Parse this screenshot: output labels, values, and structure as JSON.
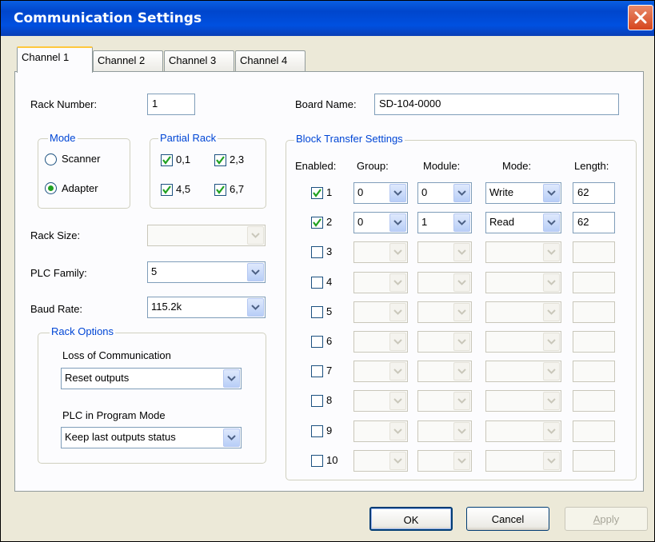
{
  "window": {
    "title": "Communication Settings"
  },
  "tabs": [
    {
      "label": "Channel 1",
      "active": true
    },
    {
      "label": "Channel 2",
      "active": false
    },
    {
      "label": "Channel 3",
      "active": false
    },
    {
      "label": "Channel 4",
      "active": false
    }
  ],
  "rack_number": {
    "label": "Rack Number:",
    "value": "1"
  },
  "board_name": {
    "label": "Board Name:",
    "value": "SD-104-0000"
  },
  "mode": {
    "legend": "Mode",
    "options": [
      {
        "label": "Scanner",
        "selected": false
      },
      {
        "label": "Adapter",
        "selected": true
      }
    ]
  },
  "partial_rack": {
    "legend": "Partial Rack",
    "items": [
      {
        "label": "0,1",
        "checked": true
      },
      {
        "label": "2,3",
        "checked": true
      },
      {
        "label": "4,5",
        "checked": true
      },
      {
        "label": "6,7",
        "checked": true
      }
    ]
  },
  "rack_size": {
    "label": "Rack Size:",
    "value": "",
    "enabled": false
  },
  "plc_family": {
    "label": "PLC Family:",
    "value": "5"
  },
  "baud_rate": {
    "label": "Baud Rate:",
    "value": "115.2k"
  },
  "rack_options": {
    "legend": "Rack Options",
    "loss_of_comm": {
      "label": "Loss of Communication",
      "value": "Reset outputs"
    },
    "program_mode": {
      "label": "PLC in Program Mode",
      "value": "Keep last outputs status"
    }
  },
  "block_transfer": {
    "legend": "Block Transfer Settings",
    "headers": {
      "enabled": "Enabled:",
      "group": "Group:",
      "module": "Module:",
      "mode": "Mode:",
      "length": "Length:"
    },
    "rows": [
      {
        "num": "1",
        "checked": true,
        "group": "0",
        "module": "0",
        "mode": "Write",
        "length": "62"
      },
      {
        "num": "2",
        "checked": true,
        "group": "0",
        "module": "1",
        "mode": "Read",
        "length": "62"
      },
      {
        "num": "3",
        "checked": false,
        "group": "",
        "module": "",
        "mode": "",
        "length": ""
      },
      {
        "num": "4",
        "checked": false,
        "group": "",
        "module": "",
        "mode": "",
        "length": ""
      },
      {
        "num": "5",
        "checked": false,
        "group": "",
        "module": "",
        "mode": "",
        "length": ""
      },
      {
        "num": "6",
        "checked": false,
        "group": "",
        "module": "",
        "mode": "",
        "length": ""
      },
      {
        "num": "7",
        "checked": false,
        "group": "",
        "module": "",
        "mode": "",
        "length": ""
      },
      {
        "num": "8",
        "checked": false,
        "group": "",
        "module": "",
        "mode": "",
        "length": ""
      },
      {
        "num": "9",
        "checked": false,
        "group": "",
        "module": "",
        "mode": "",
        "length": ""
      },
      {
        "num": "10",
        "checked": false,
        "group": "",
        "module": "",
        "mode": "",
        "length": ""
      }
    ]
  },
  "buttons": {
    "ok": "OK",
    "cancel": "Cancel",
    "apply": "Apply"
  },
  "colors": {
    "titlebar": "#0054e3",
    "legend_text": "#0046d5",
    "check_mark": "#21a121",
    "close_button": "#d6451d"
  }
}
